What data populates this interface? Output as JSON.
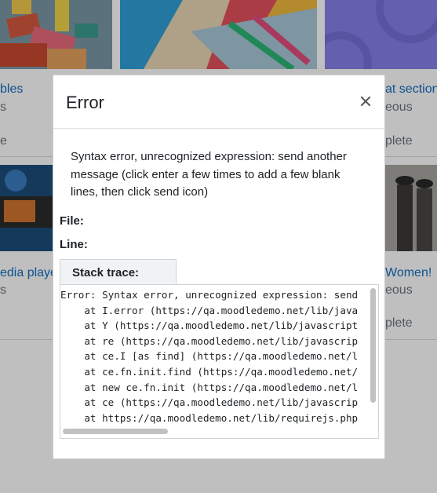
{
  "background": {
    "cards": [
      {
        "title": "bles",
        "category": "s",
        "status": "e"
      },
      {
        "title": "at section",
        "category": "eous",
        "status": "plete"
      },
      {
        "title": "edia player",
        "category": "s",
        "status": ""
      },
      {
        "title": "Women!",
        "category": "eous",
        "status": "plete"
      }
    ]
  },
  "modal": {
    "title": "Error",
    "close_label": "Close",
    "message": "Syntax error, unrecognized expression: send another message (click enter a few times to add a few blank lines, then click send icon)",
    "file_label": "File:",
    "line_label": "Line:",
    "stack_trace_label": "Stack trace:",
    "stack_trace": "Error: Syntax error, unrecognized expression: send\n    at I.error (https://qa.moodledemo.net/lib/java\n    at Y (https://qa.moodledemo.net/lib/javascript\n    at re (https://qa.moodledemo.net/lib/javascrip\n    at ce.I [as find] (https://qa.moodledemo.net/l\n    at ce.fn.init.find (https://qa.moodledemo.net/\n    at new ce.fn.init (https://qa.moodledemo.net/l\n    at ce (https://qa.moodledemo.net/lib/javascrip\n    at https://qa.moodledemo.net/lib/requirejs.php\n    at https://qa.moodledemo.net/lib/requirejs.php"
  },
  "colors": {
    "link": "#0f6cbf",
    "overlay": "rgba(0,0,0,0.25)"
  }
}
